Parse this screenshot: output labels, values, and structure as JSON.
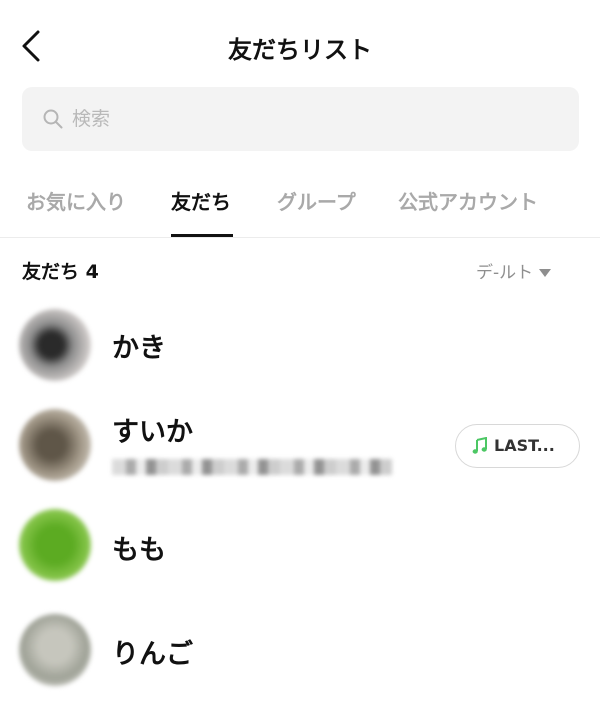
{
  "header": {
    "title": "友だちリスト",
    "back_icon": "chevron-left-icon"
  },
  "search": {
    "placeholder": "検索",
    "icon": "search-icon"
  },
  "tabs": [
    {
      "label": "お気に入り",
      "active": false
    },
    {
      "label": "友だち",
      "active": true
    },
    {
      "label": "グループ",
      "active": false
    },
    {
      "label": "公式アカウント",
      "active": false
    }
  ],
  "section": {
    "title": "友だち 4",
    "sort_label": "デ-ルト"
  },
  "friends": [
    {
      "name": "かき"
    },
    {
      "name": "すいか",
      "music_label": "LAST..."
    },
    {
      "name": "もも"
    },
    {
      "name": "りんご"
    }
  ],
  "colors": {
    "music_icon": "#4cc764",
    "active_tab": "#111111",
    "inactive_tab": "#a9a9a9"
  }
}
